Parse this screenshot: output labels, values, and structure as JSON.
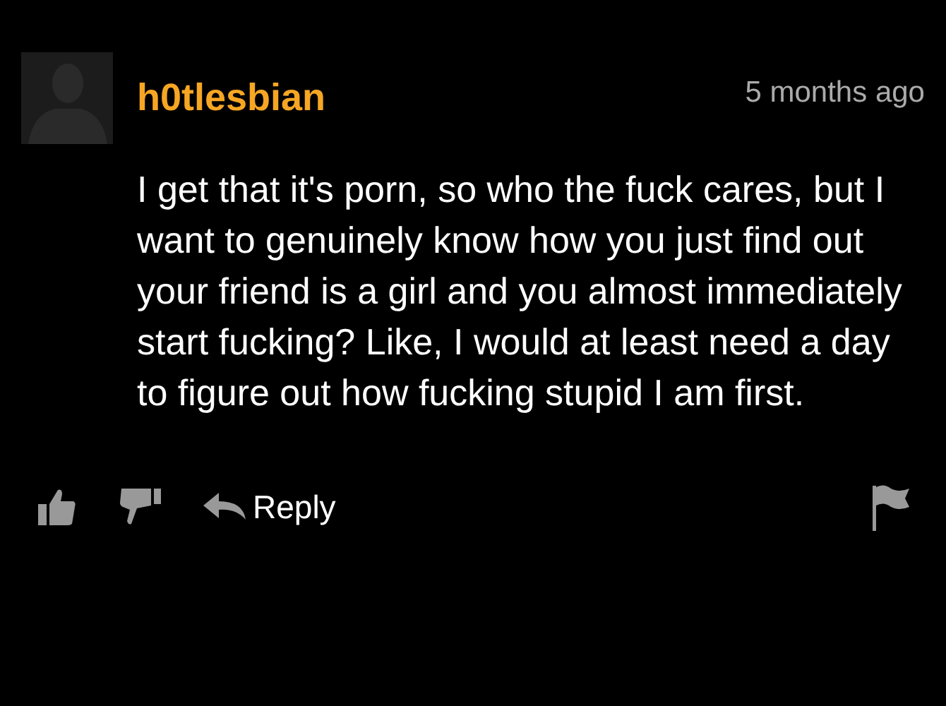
{
  "comment": {
    "author": "h0tlesbian",
    "time": "5 months ago",
    "body": "I get that it's porn, so who the fuck cares, but I want to genuinely know how you just find out your friend is a girl and you almost immediately start fucking? Like, I would at least need a day to figure out how fucking stupid I am first.",
    "actions": {
      "reply": "Reply"
    }
  }
}
